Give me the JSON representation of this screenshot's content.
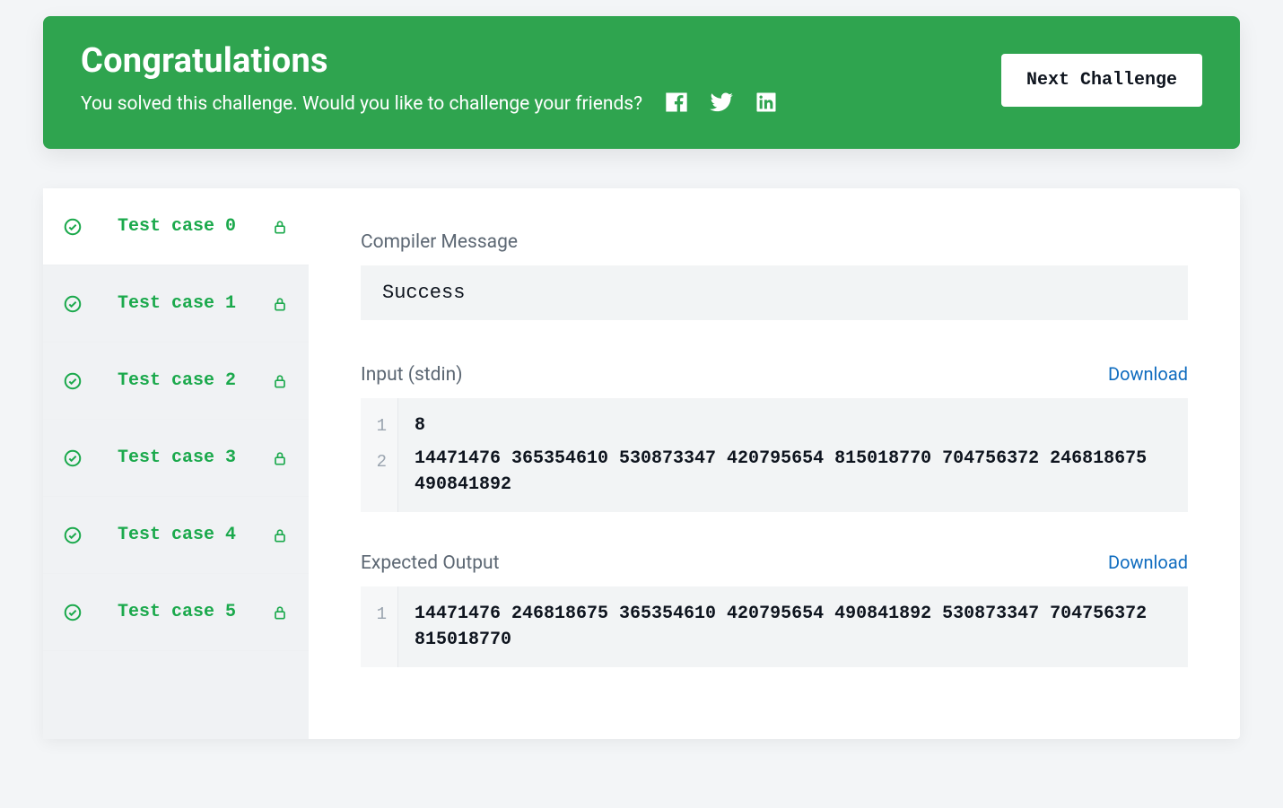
{
  "banner": {
    "title": "Congratulations",
    "subtitle": "You solved this challenge. Would you like to challenge your friends?",
    "next_label": "Next Challenge"
  },
  "sidebar": {
    "items": [
      {
        "label": "Test case 0",
        "active": true
      },
      {
        "label": "Test case 1",
        "active": false
      },
      {
        "label": "Test case 2",
        "active": false
      },
      {
        "label": "Test case 3",
        "active": false
      },
      {
        "label": "Test case 4",
        "active": false
      },
      {
        "label": "Test case 5",
        "active": false
      }
    ]
  },
  "detail": {
    "compiler_label": "Compiler Message",
    "compiler_value": "Success",
    "input_label": "Input (stdin)",
    "output_label": "Expected Output",
    "download_label": "Download",
    "input_lines": [
      "8",
      "14471476 365354610 530873347 420795654 815018770 704756372 246818675 490841892"
    ],
    "output_lines": [
      "14471476 246818675 365354610 420795654 490841892 530873347 704756372 815018770"
    ]
  }
}
